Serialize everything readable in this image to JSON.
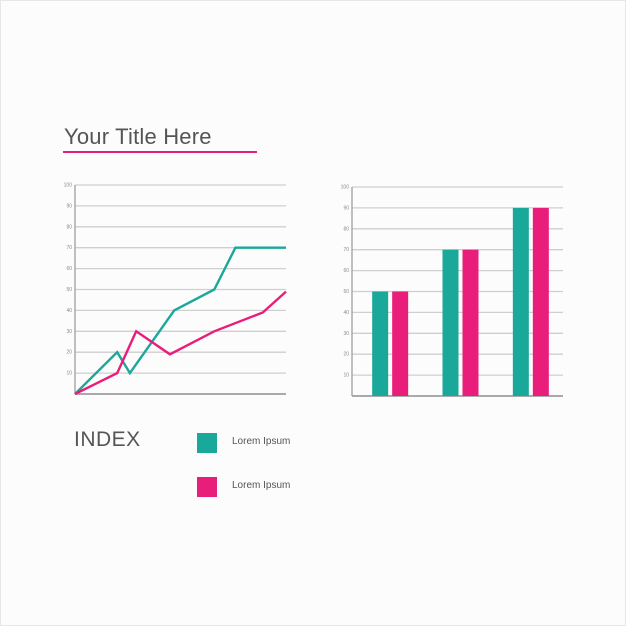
{
  "title": "Your Title Here",
  "index_label": "INDEX",
  "colors": {
    "teal": "#1aa89b",
    "pink": "#e91e7a",
    "grid": "#cfcfcf",
    "axis": "#9e9e9e"
  },
  "legend": [
    {
      "label": "Lorem Ipsum",
      "color": "#1aa89b"
    },
    {
      "label": "Lorem Ipsum",
      "color": "#e91e7a"
    }
  ],
  "chart_data": [
    {
      "type": "line",
      "ylim": [
        0,
        100
      ],
      "yticks": [
        "10",
        "20",
        "30",
        "40",
        "50",
        "60",
        "70",
        "80",
        "90",
        "100"
      ],
      "grid": true,
      "series": [
        {
          "color": "#1aa89b",
          "x": [
            0,
            20,
            26,
            47,
            66,
            76,
            100
          ],
          "y": [
            0,
            20,
            10,
            40,
            50,
            70,
            70
          ]
        },
        {
          "color": "#e91e7a",
          "x": [
            0,
            20,
            29,
            45,
            66,
            89,
            100
          ],
          "y": [
            0,
            10,
            30,
            19,
            30,
            39,
            49
          ]
        }
      ]
    },
    {
      "type": "bar",
      "ylim": [
        0,
        100
      ],
      "yticks": [
        "10",
        "20",
        "30",
        "40",
        "50",
        "60",
        "70",
        "80",
        "90",
        "100"
      ],
      "grid": true,
      "categories": [
        "",
        "",
        ""
      ],
      "series": [
        {
          "color": "#1aa89b",
          "values": [
            50,
            70,
            90
          ]
        },
        {
          "color": "#e91e7a",
          "values": [
            50,
            70,
            90
          ]
        }
      ]
    }
  ]
}
